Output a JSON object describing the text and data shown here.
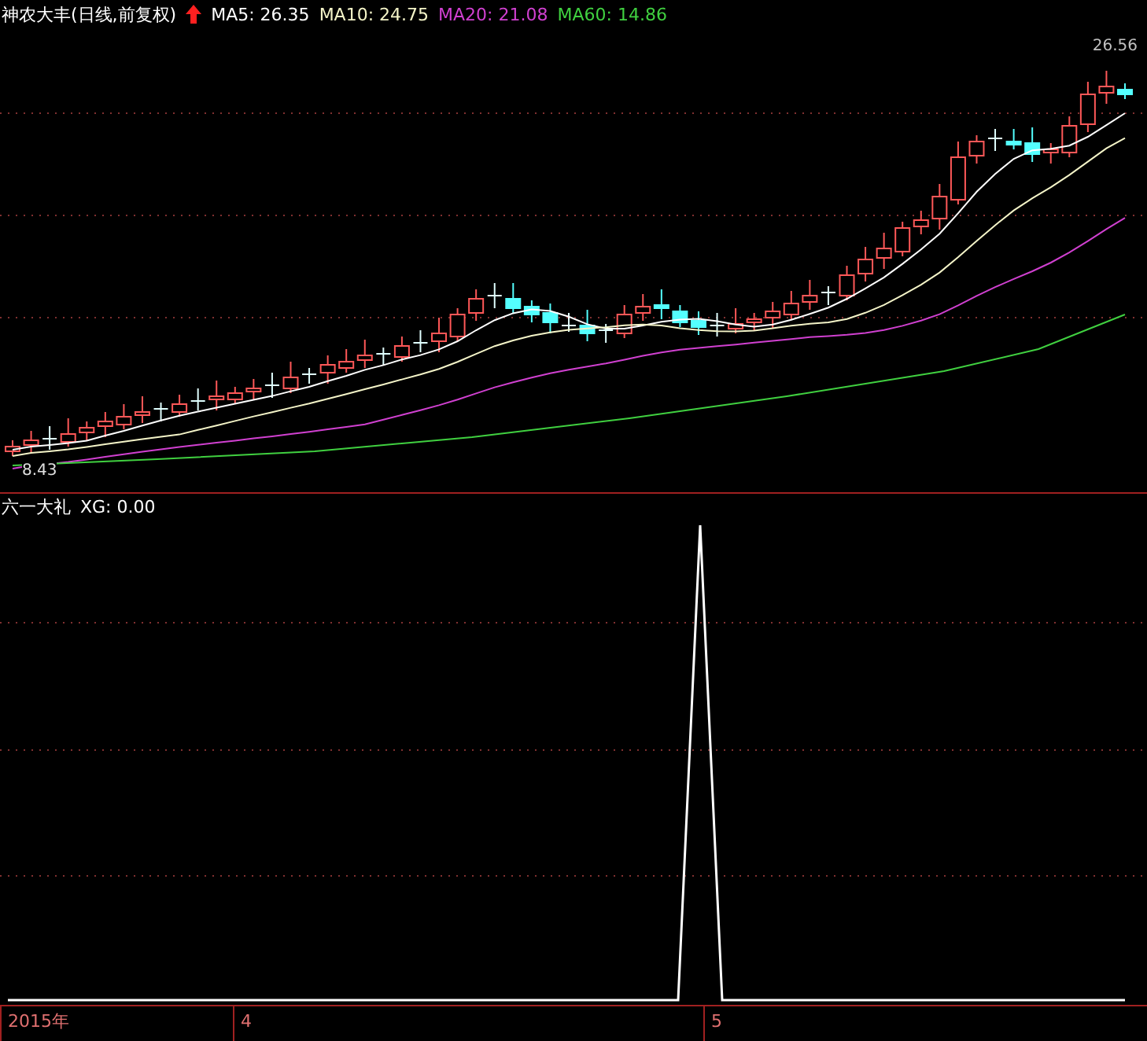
{
  "main_panel": {
    "title": "神农大丰(日线,前复权)",
    "ma_readings": [
      {
        "label": "MA5: 26.35",
        "color": "#ffffff"
      },
      {
        "label": "MA10: 24.75",
        "color": "#f4f4c8"
      },
      {
        "label": "MA20: 21.08",
        "color": "#d040d0"
      },
      {
        "label": "MA60: 14.86",
        "color": "#40d040"
      }
    ],
    "high_label": "26.56",
    "low_label": "8.43"
  },
  "indicator_panel": {
    "title": "六一大礼",
    "reading": "XG: 0.00"
  },
  "time_axis": [
    "2015年",
    "4",
    "5"
  ]
}
